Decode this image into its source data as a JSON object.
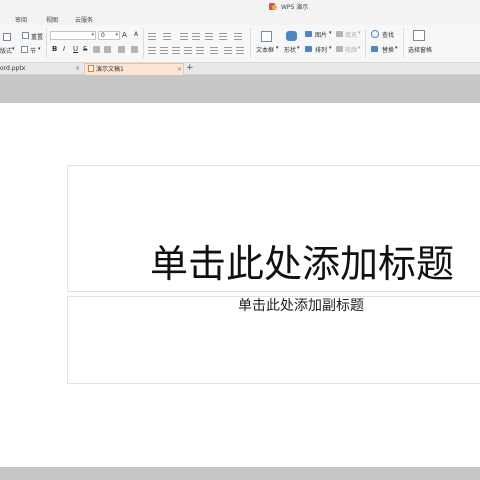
{
  "window": {
    "title": "WPS 演示"
  },
  "ribbon_tabs": [
    "审阅",
    "视图",
    "云服务"
  ],
  "ribbon": {
    "reset_label": "重置",
    "layout_label": "版式",
    "section_label": "节",
    "font_name": "",
    "font_size": "0",
    "grow_font": "A",
    "shrink_font": "A",
    "bold": "B",
    "italic": "I",
    "underline": "U",
    "strike": "S",
    "textbox_label": "文本框",
    "shape_label": "形状",
    "arrange_label": "排列",
    "picture_label": "图片",
    "fill_label": "填充",
    "outline_label": "轮廓",
    "find_label": "查找",
    "replace_label": "替换",
    "select_pane_label": "选择窗格"
  },
  "doc_tabs": [
    {
      "label": "ord.pptx"
    },
    {
      "label": "演示文稿1"
    }
  ],
  "slide": {
    "title_placeholder": "单击此处添加标题",
    "subtitle_placeholder": "单击此处添加副标题"
  },
  "colors": {
    "active_tab_bg": "#fbe6d6",
    "accent": "#e07a36",
    "workspace": "#c6c6c6"
  }
}
